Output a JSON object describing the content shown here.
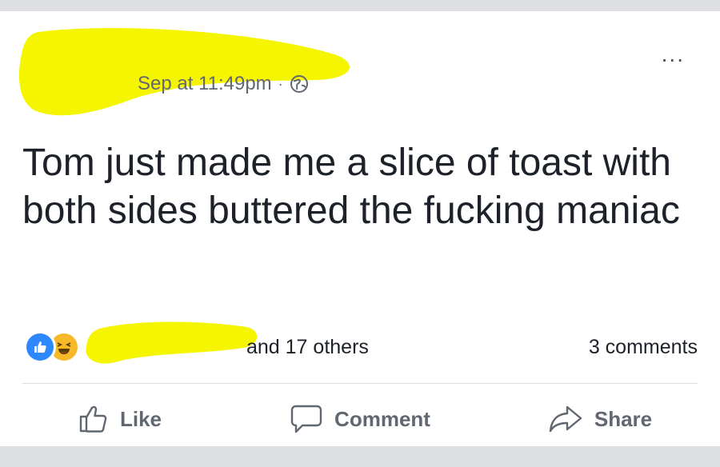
{
  "post": {
    "timestamp": "Sep at 11:49pm",
    "separator": "·",
    "privacy_icon": "globe-icon",
    "more_label": "...",
    "text": "Tom just made me a slice of toast with both sides buttered the fucking maniac"
  },
  "reactions": {
    "types": [
      "like-icon",
      "haha-icon"
    ],
    "summary": "and 17 others",
    "comments": "3 comments"
  },
  "actions": {
    "like": "Like",
    "comment": "Comment",
    "share": "Share"
  },
  "colors": {
    "redaction": "#f5f500",
    "like_blue": "#2d88ff",
    "haha_yellow": "#f7b928",
    "action_gray": "#606770",
    "text_dark": "#1d2129",
    "background": "#dddfe2"
  }
}
